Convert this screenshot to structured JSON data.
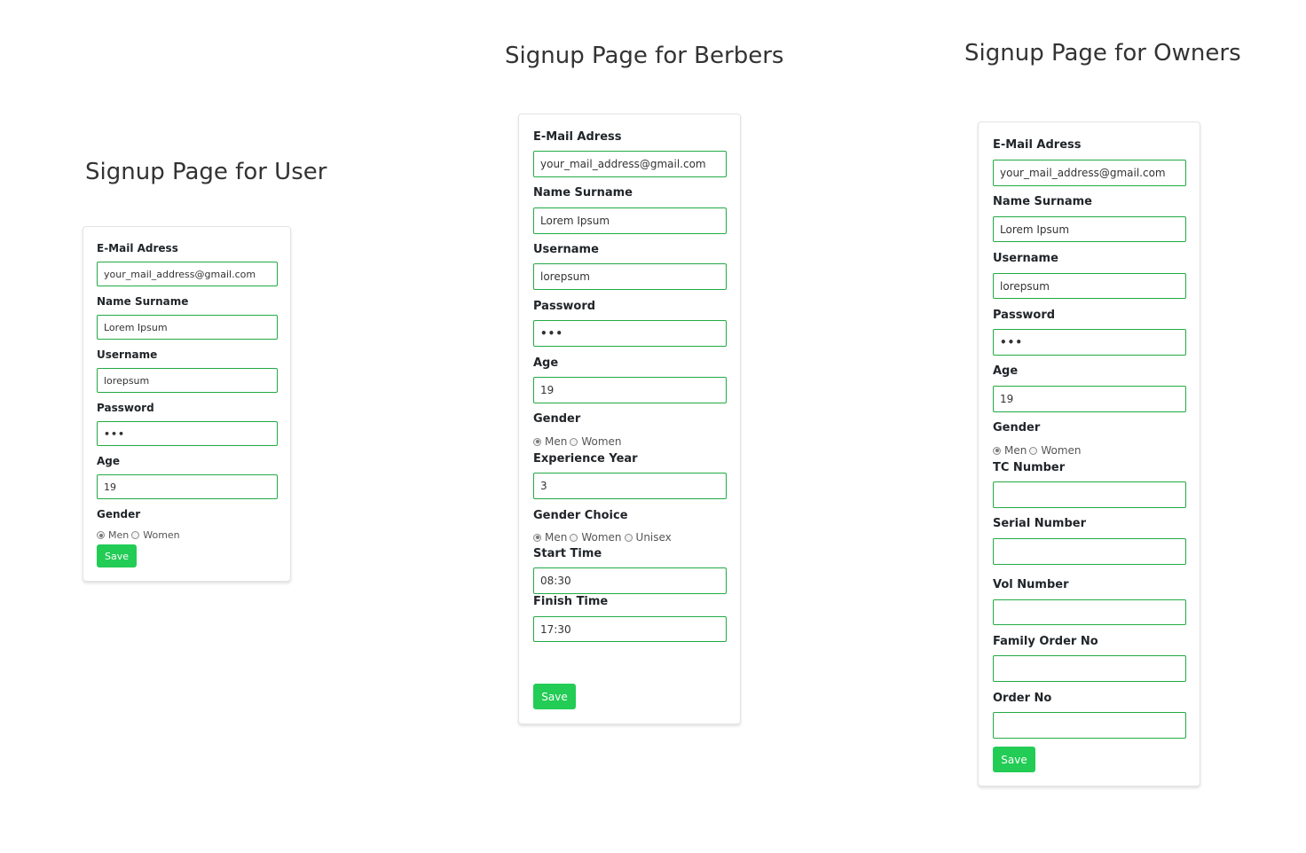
{
  "user": {
    "title": "Signup Page for User",
    "email_label": "E-Mail Adress",
    "email_value": "your_mail_address@gmail.com",
    "name_label": "Name Surname",
    "name_value": "Lorem Ipsum",
    "username_label": "Username",
    "username_value": "lorepsum",
    "password_label": "Password",
    "password_value": "•••",
    "age_label": "Age",
    "age_value": "19",
    "gender_label": "Gender",
    "gender_options": [
      {
        "label": "Men",
        "checked": true
      },
      {
        "label": "Women",
        "checked": false
      }
    ],
    "save_label": "Save"
  },
  "berber": {
    "title": "Signup Page for Berbers",
    "email_label": "E-Mail Adress",
    "email_value": "your_mail_address@gmail.com",
    "name_label": "Name Surname",
    "name_value": "Lorem Ipsum",
    "username_label": "Username",
    "username_value": "lorepsum",
    "password_label": "Password",
    "password_value": "•••",
    "age_label": "Age",
    "age_value": "19",
    "gender_label": "Gender",
    "gender_options": [
      {
        "label": "Men",
        "checked": true
      },
      {
        "label": "Women",
        "checked": false
      }
    ],
    "experience_label": "Experience Year",
    "experience_value": "3",
    "gender_choice_label": "Gender Choice",
    "gender_choice_options": [
      {
        "label": "Men",
        "checked": true
      },
      {
        "label": "Women",
        "checked": false
      },
      {
        "label": "Unisex",
        "checked": false
      }
    ],
    "start_label": "Start Time",
    "start_value": "08:30",
    "finish_label": "Finish Time",
    "finish_value": "17:30",
    "save_label": "Save"
  },
  "owner": {
    "title": "Signup Page for Owners",
    "email_label": "E-Mail Adress",
    "email_value": "your_mail_address@gmail.com",
    "name_label": "Name Surname",
    "name_value": "Lorem Ipsum",
    "username_label": "Username",
    "username_value": "lorepsum",
    "password_label": "Password",
    "password_value": "•••",
    "age_label": "Age",
    "age_value": "19",
    "gender_label": "Gender",
    "gender_options": [
      {
        "label": "Men",
        "checked": true
      },
      {
        "label": "Women",
        "checked": false
      }
    ],
    "tc_label": "TC Number",
    "tc_value": "",
    "serial_label": "Serial Number",
    "serial_value": "",
    "vol_label": "Vol Number",
    "vol_value": "",
    "family_label": "Family Order No",
    "family_value": "",
    "order_label": "Order No",
    "order_value": "",
    "save_label": "Save"
  },
  "colors": {
    "input_border": "#22aa44",
    "save_button": "#22cc55",
    "title_text": "#333333"
  }
}
